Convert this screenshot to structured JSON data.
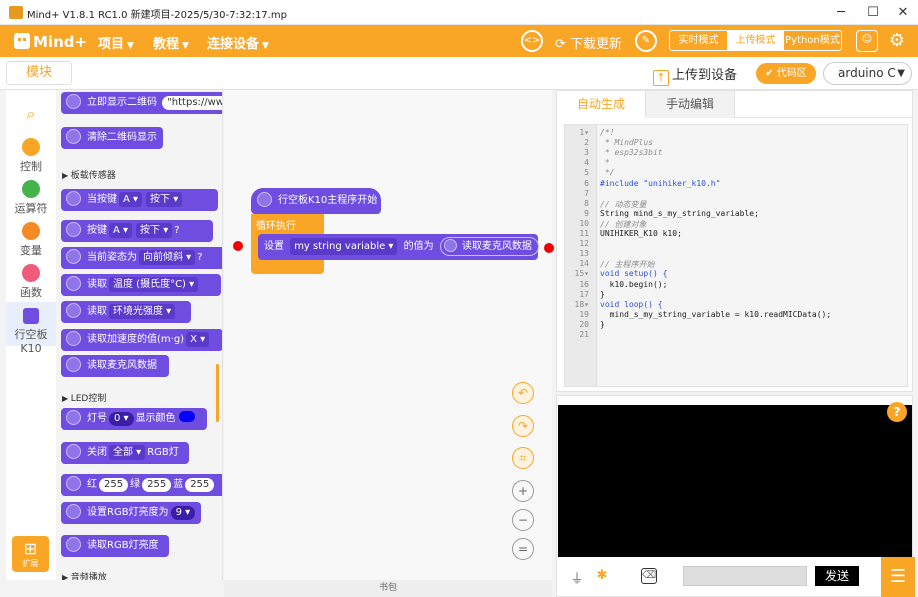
{
  "window": {
    "title": "Mind+ V1.8.1 RC1.0   新建项目-2025/5/30-7:32:17.mp",
    "minimize": "─",
    "maximize": "☐",
    "close": "✕"
  },
  "menu": {
    "logo": "Mind+",
    "items": [
      {
        "label": "项目"
      },
      {
        "label": "教程"
      },
      {
        "label": "连接设备"
      }
    ],
    "download_update": "下载更新",
    "modes": [
      {
        "label": "实时模式"
      },
      {
        "label": "上传模式"
      },
      {
        "label": "Python模式"
      }
    ],
    "active_mode": "上传模式"
  },
  "toolbar": {
    "blocks_tab": "模块",
    "upload": "上传到设备",
    "code_area": "代码区",
    "board": "arduino C"
  },
  "categories": [
    {
      "label": "控制",
      "color": "#f9a525"
    },
    {
      "label": "运算符",
      "color": "#44b449"
    },
    {
      "label": "变量",
      "color": "#f58a25"
    },
    {
      "label": "函数",
      "color": "#ef5b7a"
    },
    {
      "label": "行空板K10",
      "color": "#6e4de0"
    }
  ],
  "expand_label": "扩展",
  "flyout": {
    "blocks": [
      {
        "text": "立即显示二维码",
        "pill": "\"https://ww"
      },
      {
        "text": "清除二维码显示"
      },
      {
        "section": "板载传感器"
      },
      {
        "text": "当按键",
        "dd1": "A ▾",
        "dd2": "按下 ▾"
      },
      {
        "text": "按键",
        "dd1": "A ▾",
        "dd2": "按下 ▾",
        "tail": "?"
      },
      {
        "text": "当前姿态为",
        "dd1": "向前倾斜 ▾",
        "tail": "?"
      },
      {
        "text": "读取",
        "dd1": "温度 (摄氏度°C) ▾"
      },
      {
        "text": "读取",
        "dd1": "环境光强度 ▾"
      },
      {
        "text": "读取加速度的值(m·g)",
        "dd1": "X ▾"
      },
      {
        "text": "读取麦克风数据"
      },
      {
        "section": "LED控制"
      },
      {
        "text": "灯号",
        "pill": "0 ▾",
        "tail": "显示颜色"
      },
      {
        "text": "关闭",
        "dd1": "全部 ▾",
        "tail": "RGB灯"
      },
      {
        "text": "红",
        "pill": "255",
        "g": "绿",
        "p2": "255",
        "b": "蓝",
        "p3": "255"
      },
      {
        "text": "设置RGB灯亮度为",
        "pill": "9 ▾"
      },
      {
        "text": "读取RGB灯亮度"
      },
      {
        "section": "音频播放"
      }
    ]
  },
  "workspace": {
    "hat": "行空板K10主程序开始",
    "loop": "循环执行",
    "set": "设置",
    "var": "my string variable ▾",
    "value_of": "的值为",
    "reporter": "读取麦克风数据"
  },
  "bookmark": "书包",
  "code": {
    "tabs": [
      {
        "label": "自动生成"
      },
      {
        "label": "手动编辑"
      }
    ],
    "lines": [
      "/*!",
      " * MindPlus",
      " * esp32s3bit",
      " *",
      " */",
      "#include \"unihiker_k10.h\"",
      "",
      "// 动态变量",
      "String mind_s_my_string_variable;",
      "// 创建对象",
      "UNIHIKER_K10 k10;",
      "",
      "",
      "// 主程序开始",
      "void setup() {",
      "  k10.begin();",
      "}",
      "void loop() {",
      "  mind_s_my_string_variable = k10.readMICData();",
      "}",
      ""
    ]
  },
  "serial": {
    "send": "发送",
    "help": "?"
  }
}
